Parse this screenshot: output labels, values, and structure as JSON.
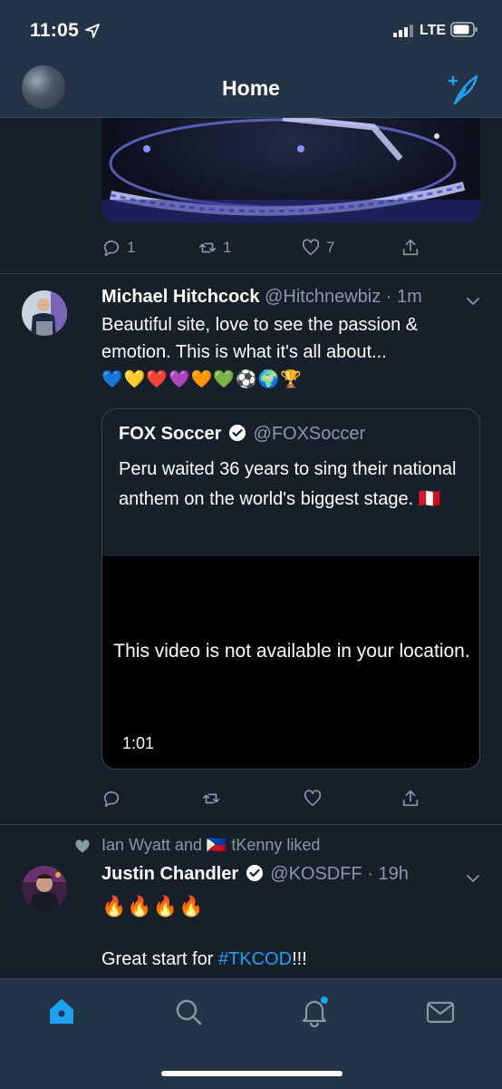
{
  "status": {
    "time": "11:05",
    "network": "LTE"
  },
  "nav": {
    "title": "Home",
    "compose_icon": "compose-feather-icon"
  },
  "tweet1": {
    "actions": {
      "reply_count": "1",
      "retweet_count": "1",
      "like_count": "7"
    }
  },
  "tweet2": {
    "name": "Michael Hitchcock",
    "handle": "@Hitchnewbiz",
    "time": "1m",
    "text": "Beautiful site, love to see the passion & emotion. This is what it's all about...",
    "emojis": "💙💛❤️💜🧡💚⚽🌍🏆",
    "quote": {
      "name": "FOX Soccer",
      "handle": "@FOXSoccer",
      "text": "Peru waited 36 years to sing their national anthem on the world's biggest stage. 🇵🇪",
      "video_message": "This video is not available in your location.",
      "video_duration": "1:01"
    }
  },
  "tweet3": {
    "social_context": "Ian Wyatt and 🇵🇭 tKenny liked",
    "name": "Justin Chandler",
    "handle": "@KOSDFF",
    "time": "19h",
    "emojis": "🔥🔥🔥🔥",
    "text_prefix": "Great start for ",
    "hashtag": "#TKCOD",
    "text_suffix": "!!!"
  },
  "tabs": [
    "home-icon",
    "search-icon",
    "notifications-icon",
    "messages-icon"
  ],
  "colors": {
    "background": "#15202b",
    "bar": "#243447",
    "accent": "#1da1f2",
    "muted": "#8899a6"
  }
}
